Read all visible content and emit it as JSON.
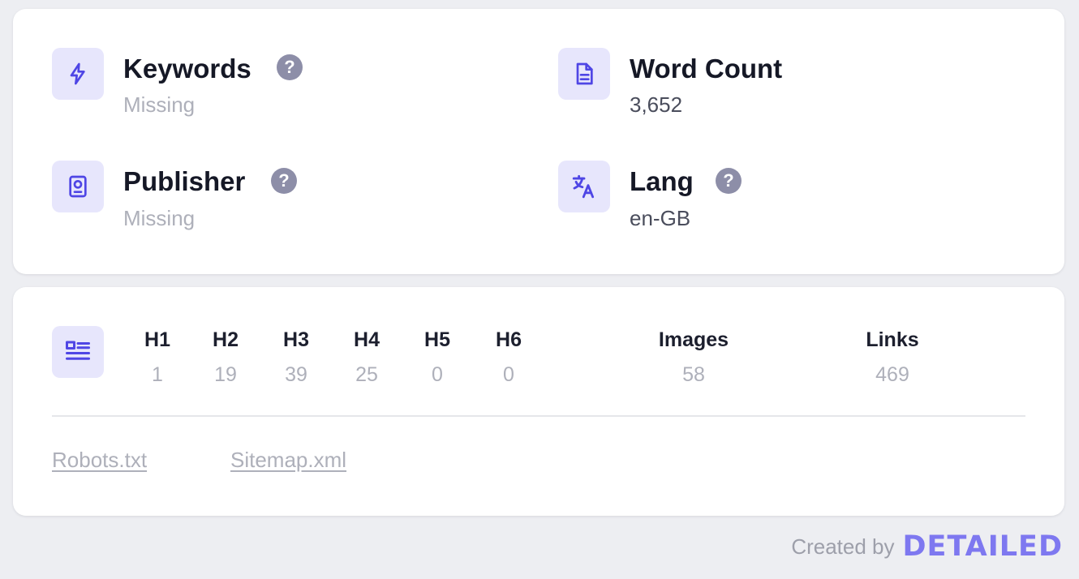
{
  "meta": {
    "keywords": {
      "title": "Keywords",
      "value": "Missing"
    },
    "word_count": {
      "title": "Word Count",
      "value": "3,652"
    },
    "publisher": {
      "title": "Publisher",
      "value": "Missing"
    },
    "lang": {
      "title": "Lang",
      "value": "en-GB"
    },
    "help_glyph": "?"
  },
  "headings": [
    {
      "label": "H1",
      "value": "1"
    },
    {
      "label": "H2",
      "value": "19"
    },
    {
      "label": "H3",
      "value": "39"
    },
    {
      "label": "H4",
      "value": "25"
    },
    {
      "label": "H5",
      "value": "0"
    },
    {
      "label": "H6",
      "value": "0"
    }
  ],
  "images": {
    "label": "Images",
    "value": "58"
  },
  "links": {
    "label": "Links",
    "value": "469"
  },
  "files": {
    "robots": "Robots.txt",
    "sitemap": "Sitemap.xml"
  },
  "footer": {
    "created_by": "Created by",
    "brand": "DETAILED"
  },
  "colors": {
    "accent": "#4f46e5",
    "icon_bg": "#e7e6fc",
    "help_bg": "#8d8ea8",
    "brand": "#7e78f0"
  }
}
